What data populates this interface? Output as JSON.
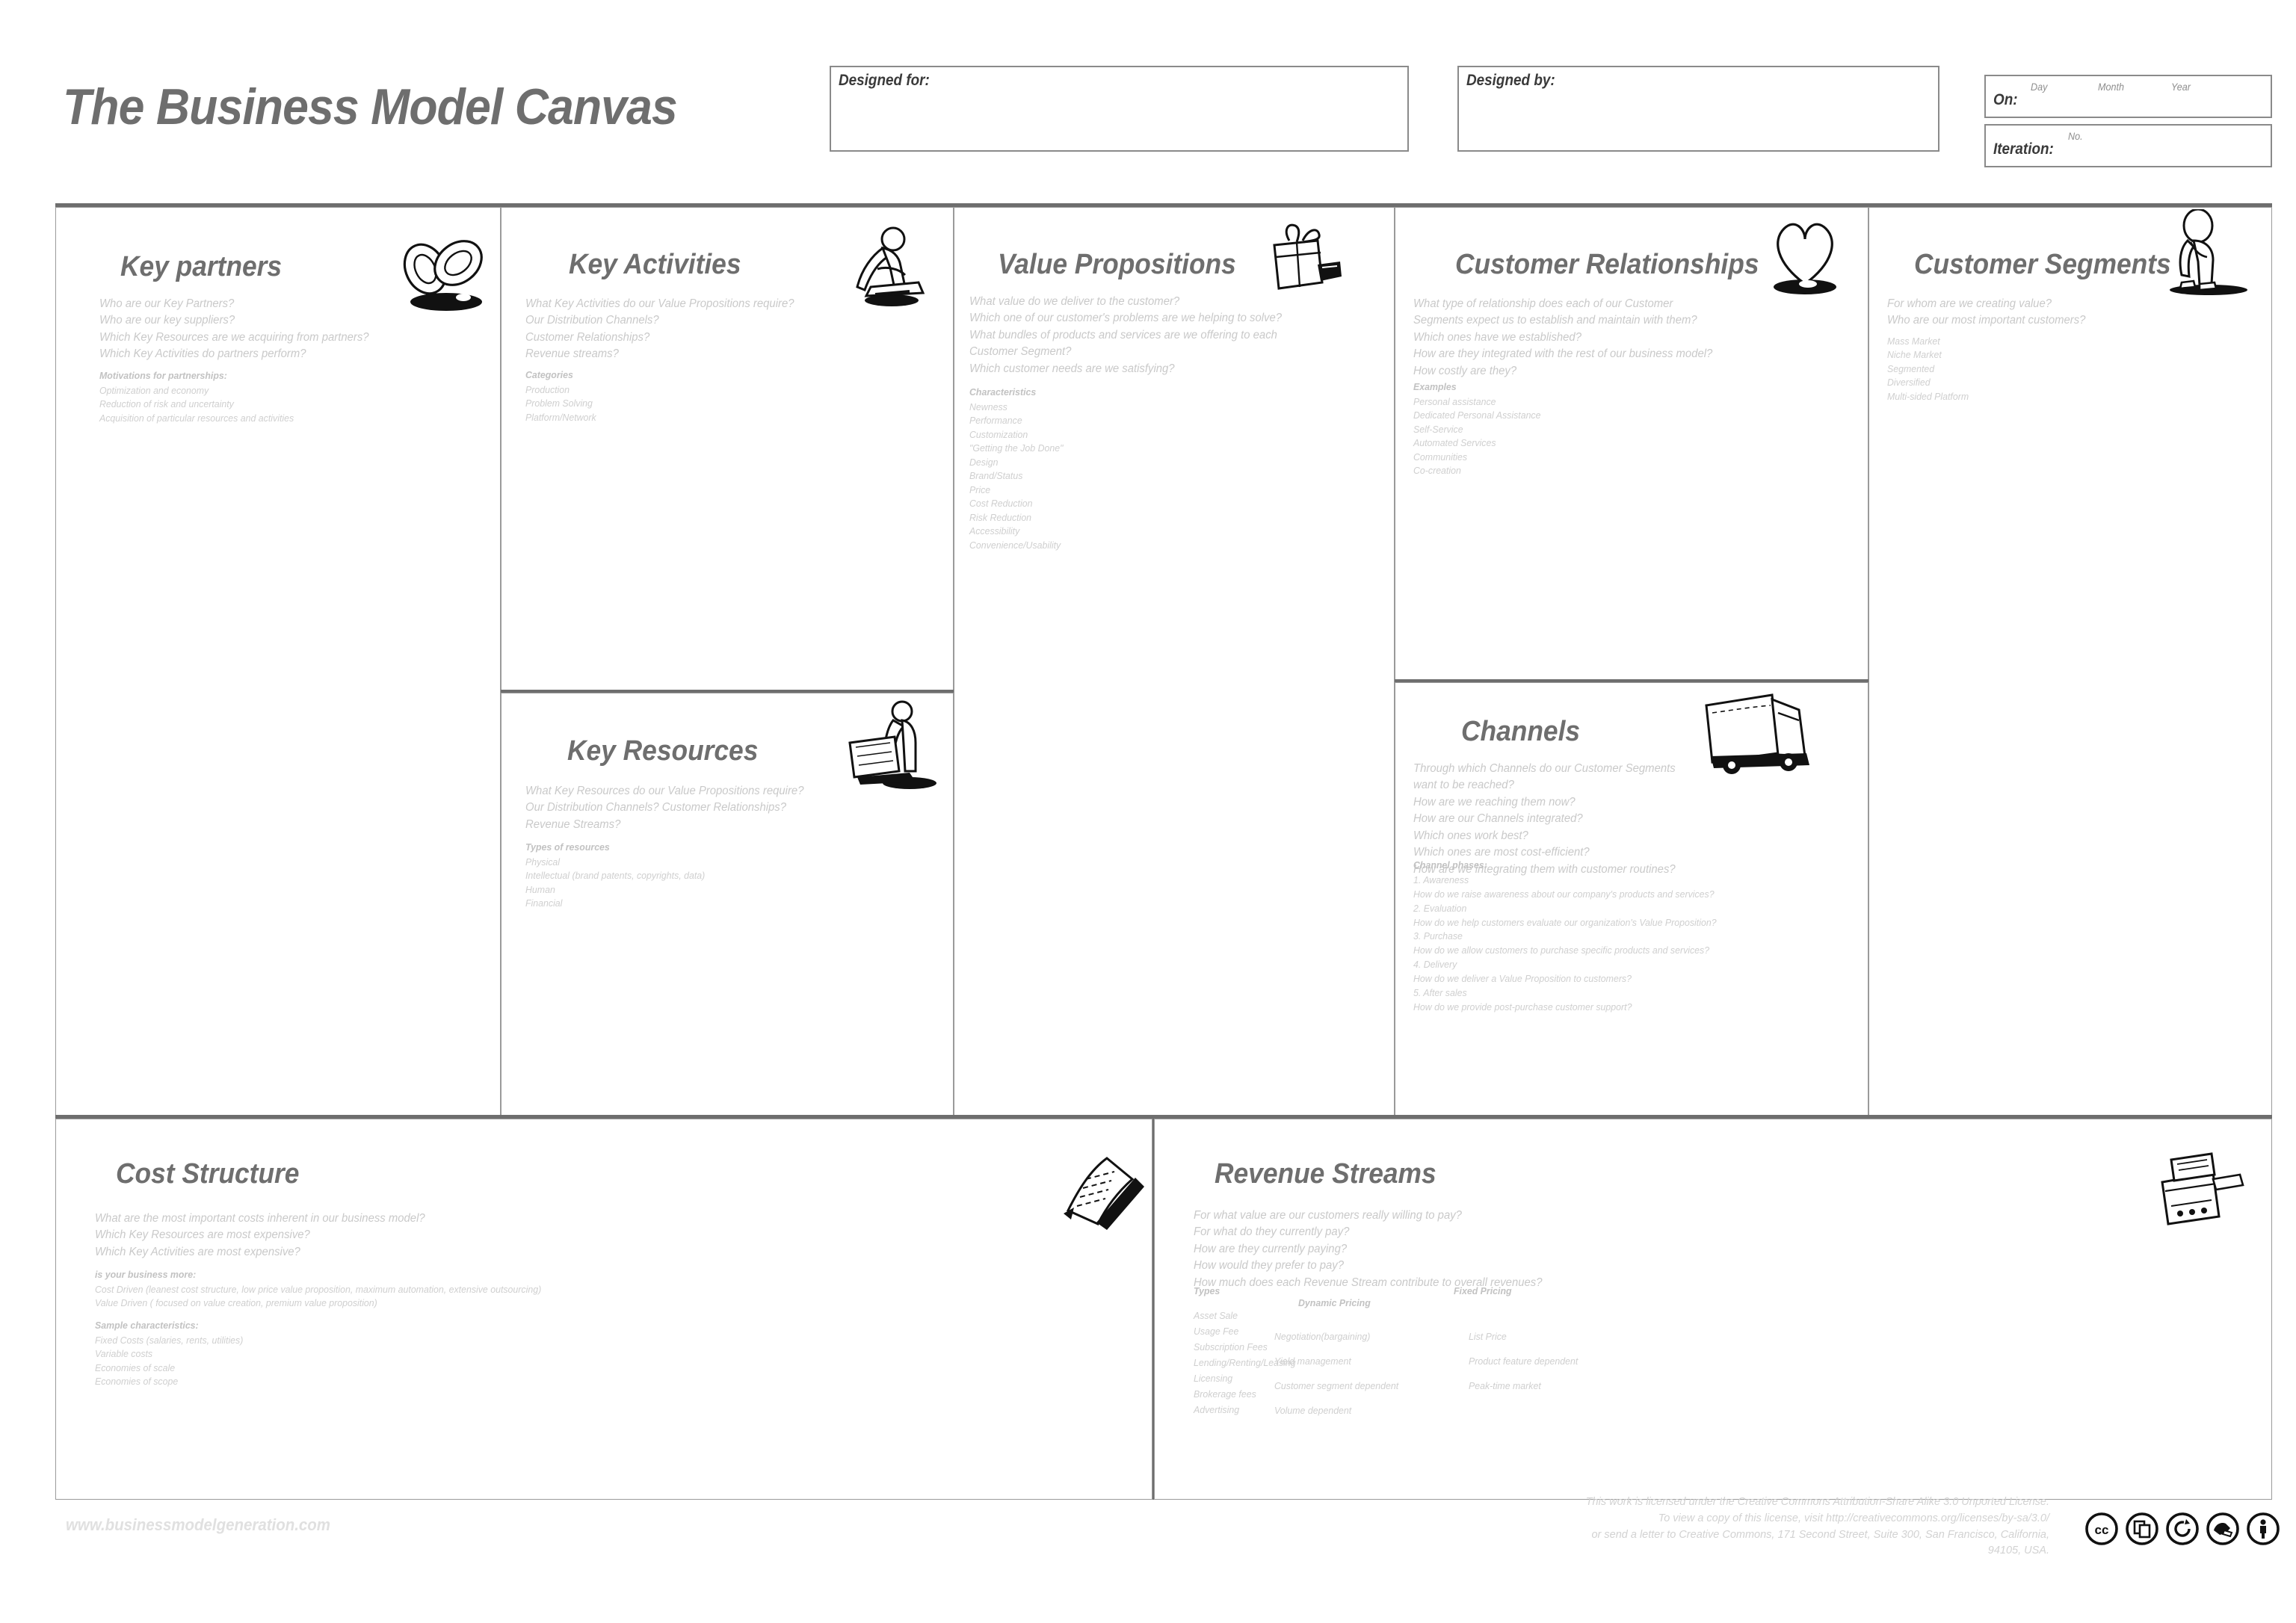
{
  "header": {
    "title": "The Business Model Canvas",
    "designed_for_label": "Designed for:",
    "designed_by_label": "Designed by:",
    "on_label": "On:",
    "on_day": "Day",
    "on_month": "Month",
    "on_year": "Year",
    "iteration_label": "Iteration:",
    "iteration_no": "No."
  },
  "blocks": {
    "key_partners": {
      "title": "Key partners",
      "icon": "chain-links-icon",
      "questions": "Who are our Key Partners?\nWho are our key suppliers?\nWhich Key Resources are we acquiring from partners?\nWhich Key Activities do partners perform?",
      "sections": [
        {
          "heading": "Motivations for partnerships:",
          "items": "Optimization and economy\nReduction of risk and uncertainty\nAcquisition of particular resources and activities"
        }
      ]
    },
    "key_activities": {
      "title": "Key Activities",
      "icon": "worker-sawing-icon",
      "questions": "What Key Activities do our Value Propositions require?\nOur Distribution Channels?\nCustomer Relationships?\nRevenue streams?",
      "sections": [
        {
          "heading": "Categories",
          "items": "Production\nProblem Solving\nPlatform/Network"
        }
      ]
    },
    "key_resources": {
      "title": "Key Resources",
      "icon": "worker-pallet-truck-icon",
      "questions": "What Key Resources do our Value Propositions require?\nOur Distribution Channels? Customer Relationships?\nRevenue Streams?",
      "sections": [
        {
          "heading": "Types of resources",
          "items": "Physical\nIntellectual (brand patents, copyrights, data)\nHuman\nFinancial"
        }
      ]
    },
    "value_propositions": {
      "title": "Value Propositions",
      "icon": "gift-package-icon",
      "questions": "What value do we deliver to the customer?\nWhich one of our customer's problems are we helping to solve?\nWhat bundles of products and services are we offering to each\nCustomer Segment?\nWhich customer needs are we satisfying?",
      "sections": [
        {
          "heading": "Characteristics",
          "items": "Newness\nPerformance\nCustomization\n\"Getting the Job Done\"\nDesign\nBrand/Status\nPrice\nCost Reduction\nRisk Reduction\nAccessibility\nConvenience/Usability"
        }
      ]
    },
    "customer_relationships": {
      "title": "Customer Relationships",
      "icon": "heart-icon",
      "questions": "What type of relationship does each of our Customer\nSegments expect us to establish and maintain with them?\nWhich ones have we established?\nHow are they integrated with the rest of our business model?\nHow costly are they?",
      "sections": [
        {
          "heading": "Examples",
          "items": "Personal assistance\nDedicated Personal Assistance\nSelf-Service\nAutomated Services\nCommunities\nCo-creation"
        }
      ]
    },
    "channels": {
      "title": "Channels",
      "icon": "delivery-truck-icon",
      "questions": "Through which Channels do our Customer Segments\nwant to be reached?\nHow are we reaching them now?\nHow are our Channels integrated?\nWhich ones work best?\nWhich ones are most cost-efficient?\nHow are we integrating them with customer routines?",
      "sections": [
        {
          "heading": "Channel phases:",
          "items": "1. Awareness\n    How do we raise awareness about our company's products and services?\n2. Evaluation\n     How do we help customers evaluate our organization's Value Proposition?\n3. Purchase\n    How do we allow customers to purchase specific products and services?\n4. Delivery\n     How do we deliver a Value Proposition to customers?\n5. After sales\n    How do we provide post-purchase customer support?"
        }
      ]
    },
    "customer_segments": {
      "title": "Customer Segments",
      "icon": "standing-person-icon",
      "questions": "For whom are we creating value?\nWho are our most important customers?",
      "sections": [
        {
          "heading": "",
          "items": "Mass Market\nNiche Market\nSegmented\nDiversified\nMulti-sided Platform"
        }
      ]
    },
    "cost_structure": {
      "title": "Cost Structure",
      "icon": "invoice-paper-icon",
      "questions": "What are the most important costs inherent in our business model?\nWhich Key Resources are most expensive?\nWhich Key Activities are most expensive?",
      "sections": [
        {
          "heading": "is your business more:",
          "items": "Cost Driven (leanest cost structure, low price value proposition, maximum automation, extensive outsourcing)\nValue Driven ( focused on value creation, premium value proposition)"
        },
        {
          "heading": "Sample characteristics:",
          "items": "Fixed Costs (salaries, rents, utilities)\nVariable costs\nEconomies of scale\nEconomies of scope"
        }
      ]
    },
    "revenue_streams": {
      "title": "Revenue Streams",
      "icon": "cash-register-icon",
      "questions": "For what value are our customers really willing to pay?\nFor what do they currently pay?\nHow are they currently paying?\nHow would they prefer to pay?\nHow much does each Revenue Stream contribute to overall revenues?",
      "types_heading": "Types",
      "dynamic_heading": "Dynamic Pricing",
      "fixed_heading": "Fixed Pricing",
      "types_items": "Asset Sale\nUsage Fee\nSubscription Fees\nLending/Renting/Leasing\nLicensing\nBrokerage fees\nAdvertising",
      "dynamic_items": "Negotiation(bargaining)\nYield management\nCustomer segment dependent\nVolume dependent",
      "fixed_items": "List Price\nProduct feature dependent\nPeak-time market"
    }
  },
  "footer": {
    "site_url": "www.businessmodelgeneration.com",
    "license_text": "This work is licensed under the Creative Commons Attribution-Share  Alike 3.0 Unported License.\nTo view a copy of this license, visit http://creativecommons.org/licenses/by-sa/3.0/\nor send a letter to Creative Commons, 171 Second Street, Suite 300, San Francisco, California,\n94105, USA.",
    "cc_icons": [
      "cc-icon",
      "remix-icon",
      "share-alike-icon",
      "adapt-icon",
      "attribution-person-icon"
    ]
  },
  "colors": {
    "title_gray": "#6e6e6e",
    "rule_gray": "#6e6e6e",
    "body_gray": "#c9c9c9",
    "cell_border": "#9a9a9a"
  }
}
